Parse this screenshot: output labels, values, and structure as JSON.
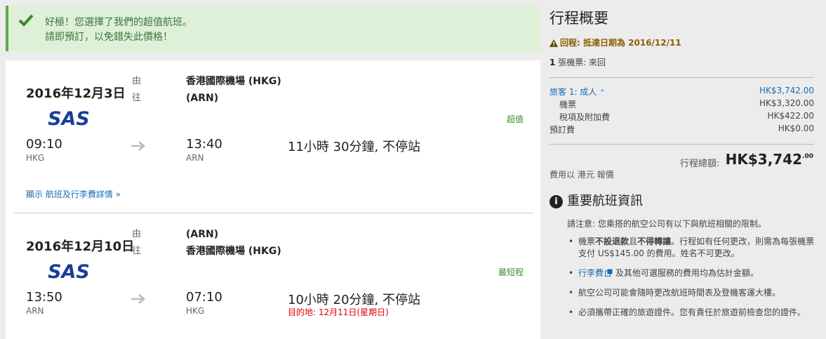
{
  "banner": {
    "line1": "好極！您選擇了我們的超值航班。",
    "line2": "請即預訂，以免錯失此價格！"
  },
  "legs": [
    {
      "date": "2016年12月3日",
      "from_label": "由",
      "to_label": "往",
      "origin_airport": "香港國際機場 (HKG)",
      "dest_airport": "(ARN)",
      "airline": "SAS",
      "tag": "超值",
      "depart_time": "09:10",
      "depart_code": "HKG",
      "arrive_time": "13:40",
      "arrive_code": "ARN",
      "duration": "11小時 30分鐘, 不停站",
      "dest_note": ""
    },
    {
      "date": "2016年12月10日",
      "from_label": "由",
      "to_label": "往",
      "origin_airport": "(ARN)",
      "dest_airport": "香港國際機場 (HKG)",
      "airline": "SAS",
      "tag": "最短程",
      "depart_time": "13:50",
      "depart_code": "ARN",
      "arrive_time": "07:10",
      "arrive_code": "HKG",
      "duration": "10小時 20分鐘, 不停站",
      "dest_note": "目的地:  12月11日(星期日)"
    }
  ],
  "details_link": "顯示 航班及行李費詳情",
  "summary": {
    "title": "行程概要",
    "warning": "回程:  抵達日期為 2016/12/11",
    "tickets_count": "1",
    "tickets_text": "張機票:  來回",
    "traveler": "旅客 1: 成人",
    "traveler_total": "HK$3,742.00",
    "ticket_label": "機票",
    "ticket_value": "HK$3,320.00",
    "tax_label": "稅項及附加費",
    "tax_value": "HK$422.00",
    "booking_fee_label": "預訂費",
    "booking_fee_value": "HK$0.00",
    "total_label": "行程總額:",
    "total_value": "HK$3,742",
    "total_cents": ".00",
    "currency_note": "費用以 港元 報價"
  },
  "info": {
    "heading": "重要航班資訊",
    "notice": "請注意:  您乘搭的航空公司有以下與航班相關的限制。",
    "bullet1_a": "機票",
    "bullet1_b": "不設退款",
    "bullet1_c": "且",
    "bullet1_d": "不得轉讓",
    "bullet1_e": "。行程如有任何更改，則需為每張機票支付 US$145.00 的費用。姓名不可更改。",
    "bullet2_link": "行李費",
    "bullet2_text": " 及其他可選服務的費用均為估計金額。",
    "bullet3": "航空公司可能會隨時更改航班時間表及登機客運大樓。",
    "bullet4": "必須攜帶正確的旅遊證件。您有責任於旅遊前檢查您的證件。"
  },
  "colors": {
    "success_bg": "#dff0d8",
    "success_border": "#5cab4a",
    "link_blue": "#1a6bb0",
    "sas_blue": "#1a3d9c",
    "warning": "#8a6100",
    "alert_red": "#dd0000"
  }
}
